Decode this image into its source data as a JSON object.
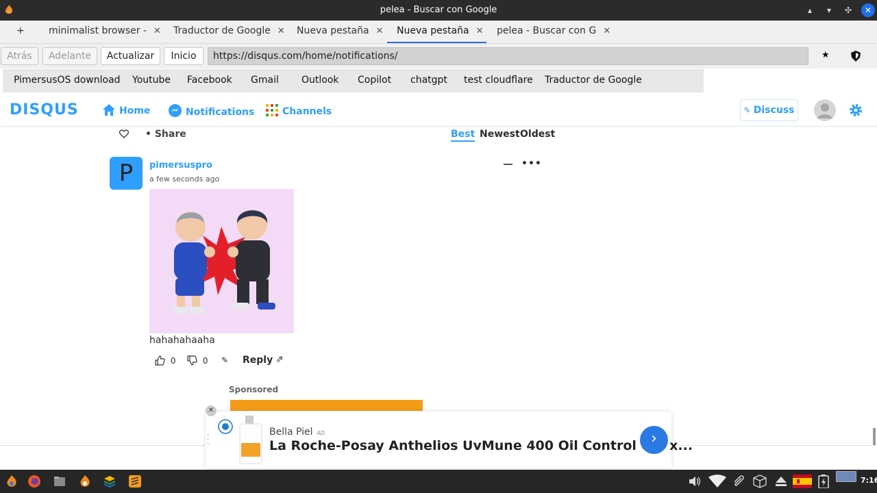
{
  "window": {
    "title": "pelea - Buscar con Google"
  },
  "tabs": [
    {
      "label": "+"
    },
    {
      "label": "minimalist browser -",
      "close": "✕"
    },
    {
      "label": "Traductor de Google",
      "close": "✕"
    },
    {
      "label": "Nueva pestaña",
      "close": "✕"
    },
    {
      "label": "Nueva pestaña",
      "close": "✕"
    },
    {
      "label": "pelea - Buscar con G",
      "close": "✕"
    }
  ],
  "nav": {
    "back": "Atrás",
    "forward": "Adelante",
    "reload": "Actualizar",
    "home": "Inicio",
    "url": "https://disqus.com/home/notifications/"
  },
  "bookmarks": [
    "PimersusOS download",
    "Youtube",
    "Facebook",
    "Gmail",
    "Outlook",
    "Copilot",
    "chatgpt",
    "test cloudflare",
    "Traductor de Google"
  ],
  "disqus": {
    "logo": "DISQUS",
    "nav": {
      "home": "Home",
      "notifications": "Notifications",
      "channels": "Channels"
    },
    "discuss": "Discuss"
  },
  "thread": {
    "share": "Share",
    "sort": {
      "best": "Best",
      "newest": "Newest",
      "oldest": "Oldest"
    },
    "comment": {
      "avatar_letter": "P",
      "author": "pimersuspro",
      "time": "a few seconds ago",
      "text": "hahahahaaha",
      "upvotes": "0",
      "downvotes": "0",
      "reply": "Reply"
    },
    "sponsored": "Sponsored"
  },
  "ad": {
    "brand": "Bella Piel",
    "ad_label": "AD",
    "title": "La Roche-Posay Anthelios UvMune 400 Oil Control Gel x..."
  },
  "taskbar": {
    "time": "7:16"
  },
  "colors": {
    "accent": "#2e9fff",
    "tab_active": "#2a6fd6"
  }
}
